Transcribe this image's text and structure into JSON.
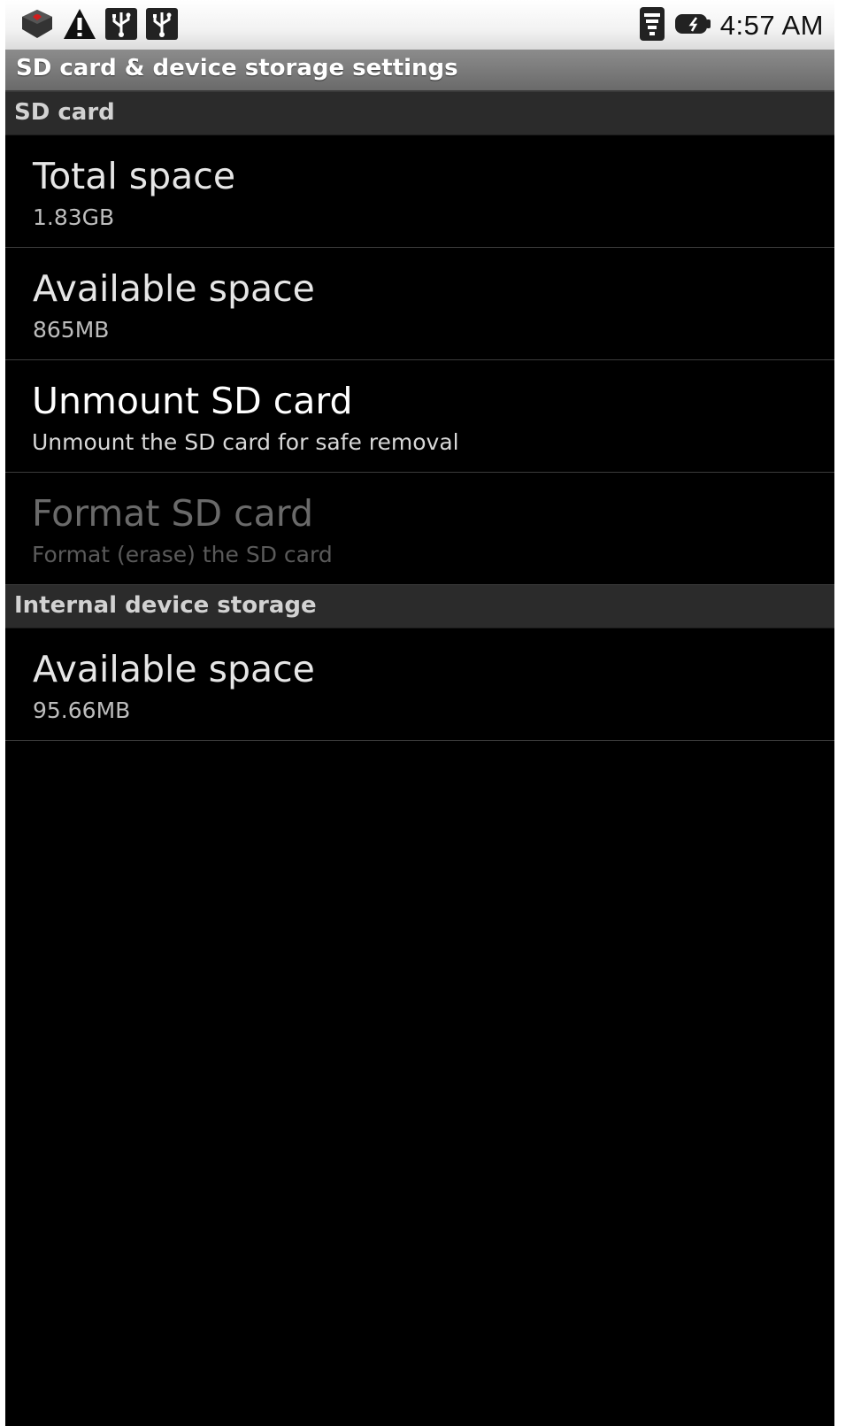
{
  "status_bar": {
    "left_icons": [
      "sd-card-icon",
      "warning-icon",
      "usb-icon",
      "usb-icon"
    ],
    "right_icons": [
      "wifi-icon",
      "battery-icon"
    ],
    "time": "4:57 AM"
  },
  "title_bar": {
    "title": "SD card & device storage settings"
  },
  "sections": {
    "sd_card": {
      "header": "SD card",
      "items": [
        {
          "title": "Total space",
          "summary": "1.83GB",
          "enabled": true
        },
        {
          "title": "Available space",
          "summary": "865MB",
          "enabled": true
        },
        {
          "title": "Unmount SD card",
          "summary": "Unmount the SD card for safe removal",
          "enabled": true
        },
        {
          "title": "Format SD card",
          "summary": "Format (erase) the SD card",
          "enabled": false
        }
      ]
    },
    "internal": {
      "header": "Internal device storage",
      "items": [
        {
          "title": "Available space",
          "summary": "95.66MB",
          "enabled": true
        }
      ]
    }
  },
  "colors": {
    "background": "#000000",
    "status_bar": "#f2f2f2",
    "title_bar": "#7a7a7a",
    "category": "#2b2b2b",
    "disabled_text": "#6a6a6a"
  }
}
